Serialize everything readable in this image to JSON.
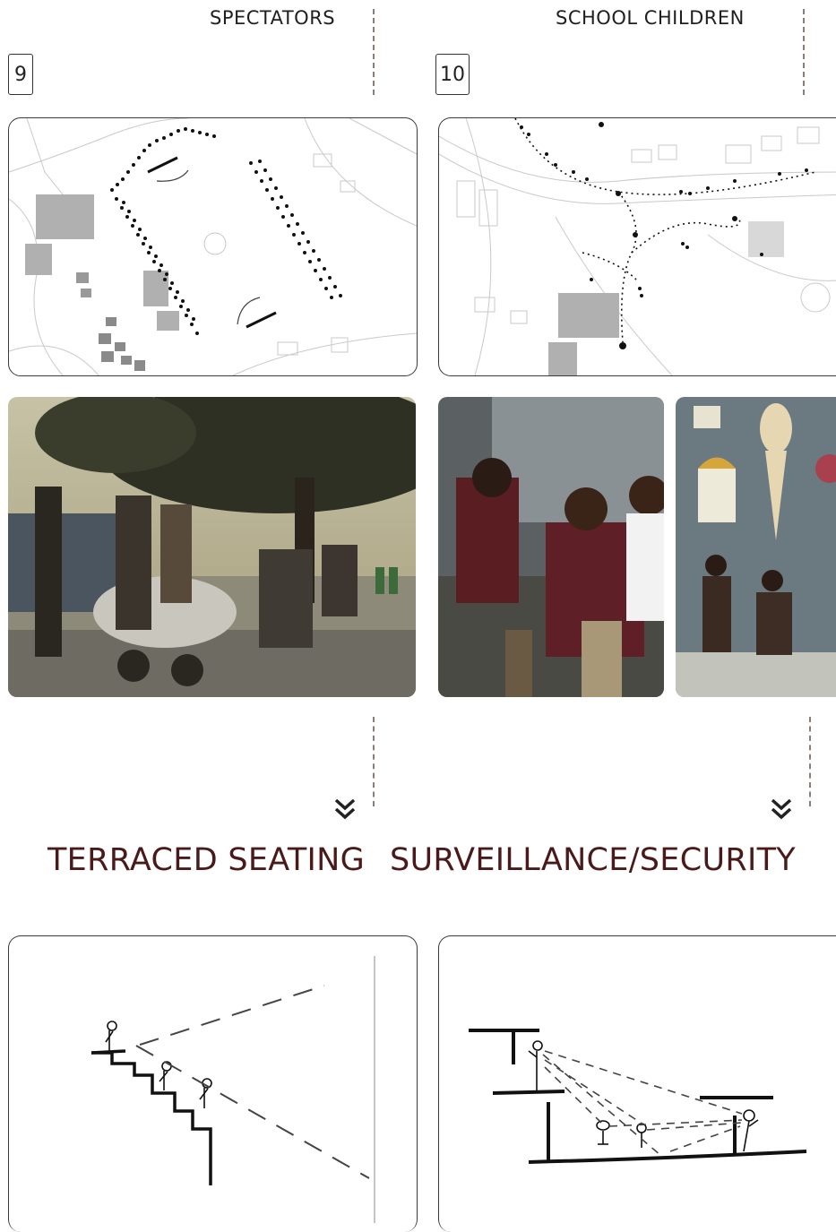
{
  "left": {
    "column_title": "SPECTATORS",
    "number": "9",
    "heading": "TERRACED SEATING"
  },
  "right": {
    "column_title": "SCHOOL CHILDREN",
    "number": "10",
    "heading": "SURVEILLANCE/SECURITY"
  },
  "icons": {
    "chevron": "double-chevron-down-icon"
  }
}
